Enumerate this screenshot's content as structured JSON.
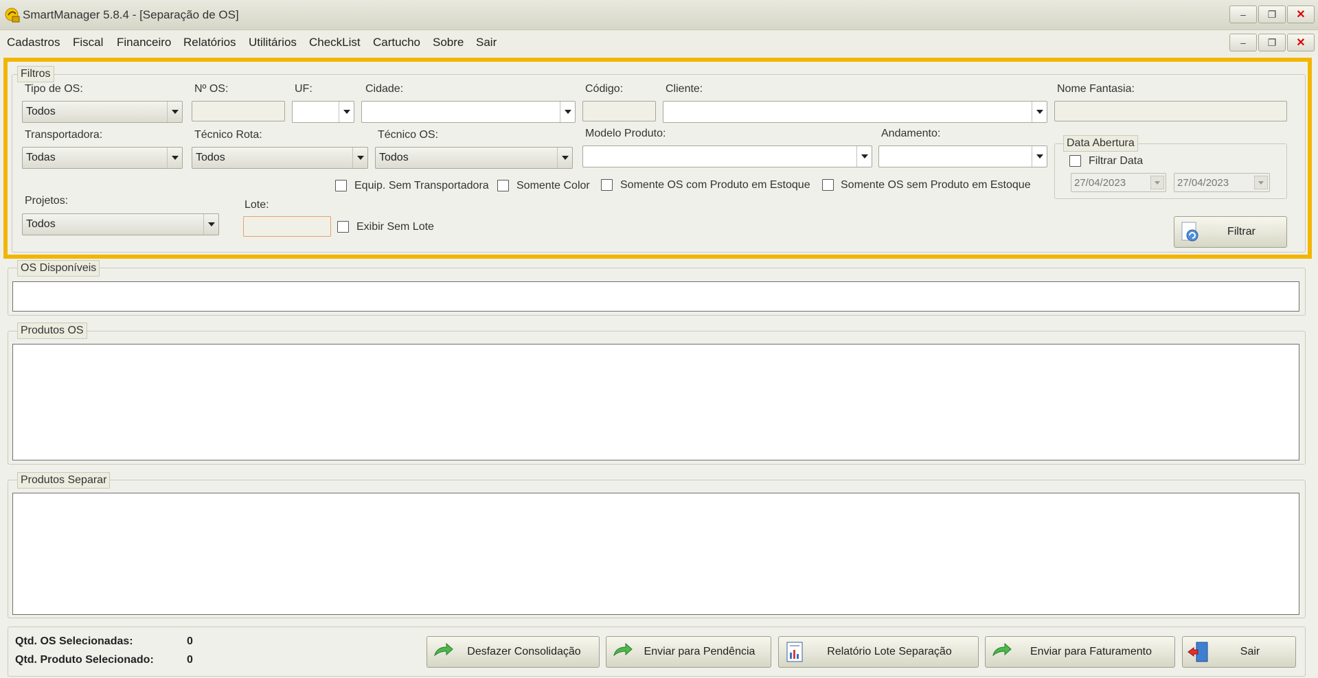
{
  "window": {
    "title": "SmartManager 5.8.4 - [Separação de OS]",
    "min_symbol": "–",
    "restore_symbol": "❐",
    "close_symbol": "✕"
  },
  "menu": [
    "Cadastros",
    "Fiscal",
    "Financeiro",
    "Relatórios",
    "Utilitários",
    "CheckList",
    "Cartucho",
    "Sobre",
    "Sair"
  ],
  "filtros": {
    "group_label": "Filtros",
    "tipo_os": {
      "label": "Tipo de OS:",
      "value": "Todos"
    },
    "num_os": {
      "label": "Nº OS:",
      "value": ""
    },
    "uf": {
      "label": "UF:",
      "value": ""
    },
    "cidade": {
      "label": "Cidade:",
      "value": ""
    },
    "codigo": {
      "label": "Código:",
      "value": ""
    },
    "cliente": {
      "label": "Cliente:",
      "value": ""
    },
    "nome_fantasia": {
      "label": "Nome Fantasia:",
      "value": ""
    },
    "transportadora": {
      "label": "Transportadora:",
      "value": "Todas"
    },
    "tecnico_rota": {
      "label": "Técnico Rota:",
      "value": "Todos"
    },
    "tecnico_os": {
      "label": "Técnico OS:",
      "value": "Todos"
    },
    "modelo_produto": {
      "label": "Modelo Produto:",
      "value": ""
    },
    "andamento": {
      "label": "Andamento:",
      "value": ""
    },
    "checkboxes": {
      "equip_sem_transportadora": "Equip. Sem Transportadora",
      "somente_color": "Somente Color",
      "somente_os_com_produto": "Somente OS com Produto em Estoque",
      "somente_os_sem_produto": "Somente OS sem Produto em Estoque"
    },
    "projetos": {
      "label": "Projetos:",
      "value": "Todos"
    },
    "lote": {
      "label": "Lote:",
      "value": ""
    },
    "exibir_sem_lote": "Exibir Sem Lote",
    "data_abertura": {
      "group_label": "Data Abertura",
      "filtrar_data": "Filtrar Data",
      "de": "27/04/2023",
      "ate": "27/04/2023"
    },
    "filtrar_button": "Filtrar"
  },
  "os_disponiveis": {
    "label": "OS Disponíveis"
  },
  "produtos_os": {
    "label": "Produtos OS"
  },
  "produtos_separar": {
    "label": "Produtos Separar"
  },
  "footer": {
    "qtd_os_label": "Qtd. OS Selecionadas:",
    "qtd_os_value": "0",
    "qtd_prod_label": "Qtd. Produto Selecionado:",
    "qtd_prod_value": "0",
    "buttons": {
      "desfazer": "Desfazer Consolidação",
      "pendencia": "Enviar para Pendência",
      "relatorio": "Relatório Lote Separação",
      "faturamento": "Enviar para Faturamento",
      "sair": "Sair"
    }
  },
  "colors": {
    "highlight": "#f2b600",
    "lote_border": "#e8a06a"
  }
}
